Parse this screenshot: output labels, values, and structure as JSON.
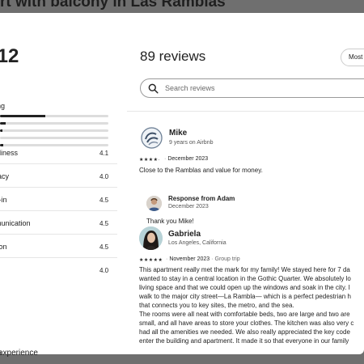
{
  "listing": {
    "title_fragment": "rt with balcony in Las Ramblas",
    "footer_fragment": "experience"
  },
  "ratings": {
    "overall_score": ".12",
    "overall_label": "ing",
    "distribution": [
      {
        "stars": 5,
        "fraction": 0.42
      },
      {
        "stars": 4,
        "fraction": 0.05
      },
      {
        "stars": 3,
        "fraction": 0.02
      },
      {
        "stars": 2,
        "fraction": 0.0
      },
      {
        "stars": 1,
        "fraction": 0.03
      }
    ],
    "categories": [
      {
        "label": "nliness",
        "score": "4.1"
      },
      {
        "label": "racy",
        "score": "4.0"
      },
      {
        "label": "k-in",
        "score": "4.5"
      },
      {
        "label": "munication",
        "score": "4.5"
      },
      {
        "label": "tion",
        "score": "4.5"
      },
      {
        "label": "e",
        "score": "4.0"
      }
    ]
  },
  "reviews_panel": {
    "title": "89 reviews",
    "sort_label": "Most r",
    "search_placeholder": "Search reviews"
  },
  "reviews": [
    {
      "name": "Mike",
      "subtitle": "9 years on Airbnb",
      "stars": "★★★★·",
      "date": "December 2023",
      "text": "Close to the Ramblas and value for money.",
      "response": {
        "title": "Response from Adam",
        "date": "December 2023",
        "text": "Thank you Mike!"
      }
    },
    {
      "name": "Gabriela",
      "subtitle": "Los Angeles, California",
      "stars": "★★★★★",
      "date": "November 2023",
      "trip": "Group trip",
      "text_lines": [
        "This apartment really met the mark for my family! We stayed here for 7 da",
        "wanted to stay in a central location in the Gothic Quarter. We absolutely lo",
        "living space and that we could open up the windows and soak in the city. I",
        "walk to the major city street—La Rambla— which is a perfect pedestrian h",
        "that connects you to key sites, the metro, and the sea.",
        "The rooms were all neat with comfortable beds, two are large and two are",
        "small, and all have areas to store your clothes. The kitchen was also very c",
        "had all the amenities we needed. We also really appreciated the key code",
        "enter the building and apartment. It made it so that everyone in our family"
      ]
    }
  ]
}
